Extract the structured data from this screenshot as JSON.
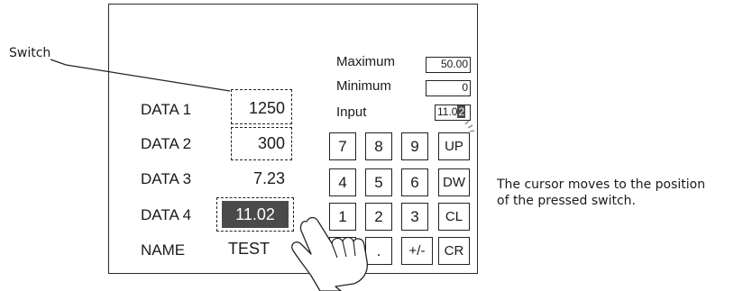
{
  "callout": {
    "switch_label": "Switch"
  },
  "data_rows": [
    {
      "label": "DATA 1",
      "value": "1250"
    },
    {
      "label": "DATA 2",
      "value": "300"
    },
    {
      "label": "DATA 3",
      "value": "7.23"
    },
    {
      "label": "DATA 4",
      "value": "11.02"
    },
    {
      "label": "NAME",
      "value": "TEST"
    }
  ],
  "limits": {
    "maximum_label": "Maximum",
    "maximum_value": "50.00",
    "minimum_label": "Minimum",
    "minimum_value": "0",
    "input_label": "Input",
    "input_value_prefix": "11.0",
    "input_value_cursor": "2"
  },
  "keypad": {
    "row1": [
      "7",
      "8",
      "9",
      "UP"
    ],
    "row2": [
      "4",
      "5",
      "6",
      "DW"
    ],
    "row3": [
      "1",
      "2",
      "3",
      "CL"
    ],
    "row4": [
      "0",
      ".",
      "+/-",
      "CR"
    ]
  },
  "note": {
    "line1": "The cursor moves to the position",
    "line2": "of the pressed switch."
  },
  "colors": {
    "highlight": "#4a4a4a",
    "stroke": "#222222"
  }
}
